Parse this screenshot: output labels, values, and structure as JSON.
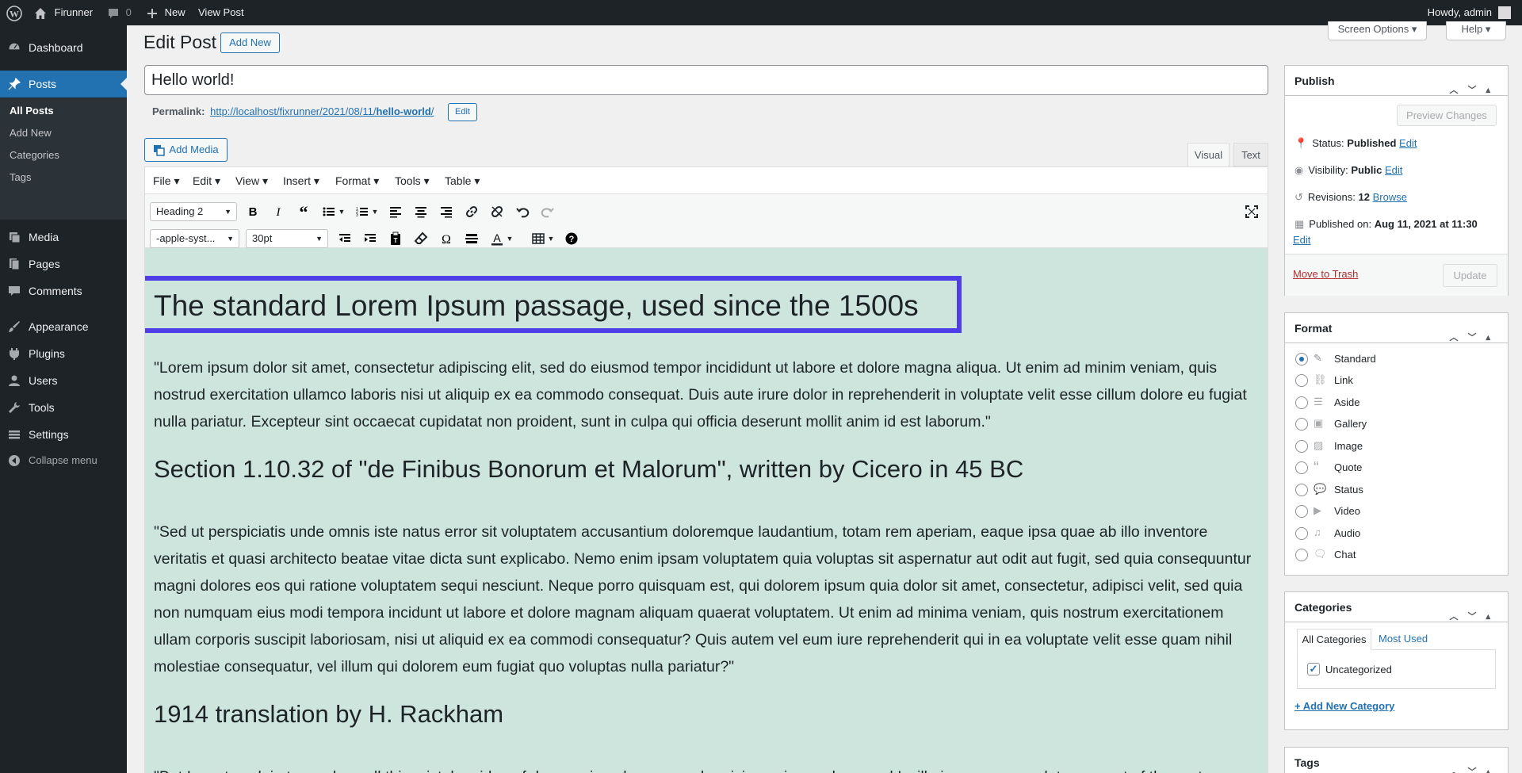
{
  "adminbar": {
    "site_name": "Firunner",
    "comments_count": "0",
    "new_label": "New",
    "view_post_label": "View Post",
    "howdy": "Howdy, admin"
  },
  "sidebar": {
    "items": [
      {
        "label": "Dashboard",
        "icon": "dashboard-icon"
      },
      {
        "label": "Posts",
        "icon": "pushpin-icon"
      },
      {
        "label": "Media",
        "icon": "media-icon"
      },
      {
        "label": "Pages",
        "icon": "pages-icon"
      },
      {
        "label": "Comments",
        "icon": "comments-icon"
      },
      {
        "label": "Appearance",
        "icon": "brush-icon"
      },
      {
        "label": "Plugins",
        "icon": "plugin-icon"
      },
      {
        "label": "Users",
        "icon": "users-icon"
      },
      {
        "label": "Tools",
        "icon": "wrench-icon"
      },
      {
        "label": "Settings",
        "icon": "settings-icon"
      },
      {
        "label": "Collapse menu",
        "icon": "collapse-icon"
      }
    ],
    "posts_sub": [
      "All Posts",
      "Add New",
      "Categories",
      "Tags"
    ]
  },
  "header": {
    "title": "Edit Post",
    "add_new": "Add New",
    "screen_options": "Screen Options",
    "help": "Help"
  },
  "post": {
    "title": "Hello world!",
    "permalink_label": "Permalink:",
    "permalink_base": "http://localhost/fixrunner/2021/08/11/",
    "permalink_slug": "hello-world",
    "permalink_end": "/",
    "permalink_edit": "Edit"
  },
  "editor": {
    "add_media": "Add Media",
    "tab_visual": "Visual",
    "tab_text": "Text",
    "menus": [
      "File",
      "Edit",
      "View",
      "Insert",
      "Format",
      "Tools",
      "Table"
    ],
    "block_format": "Heading 2",
    "font_family": "-apple-syst...",
    "font_size": "30pt"
  },
  "content": {
    "h1": "The standard Lorem Ipsum passage, used since the 1500s",
    "p1": "\"Lorem ipsum dolor sit amet, consectetur adipiscing elit, sed do eiusmod tempor incididunt ut labore et dolore magna aliqua. Ut enim ad minim veniam, quis nostrud exercitation ullamco laboris nisi ut aliquip ex ea commodo consequat. Duis aute irure dolor in reprehenderit in voluptate velit esse cillum dolore eu fugiat nulla pariatur. Excepteur sint occaecat cupidatat non proident, sunt in culpa qui officia deserunt mollit anim id est laborum.\"",
    "h2": "Section 1.10.32 of \"de Finibus Bonorum et Malorum\", written by Cicero in 45 BC",
    "p2": "\"Sed ut perspiciatis unde omnis iste natus error sit voluptatem accusantium doloremque laudantium, totam rem aperiam, eaque ipsa quae ab illo inventore veritatis et quasi architecto beatae vitae dicta sunt explicabo. Nemo enim ipsam voluptatem quia voluptas sit aspernatur aut odit aut fugit, sed quia consequuntur magni dolores eos qui ratione voluptatem sequi nesciunt. Neque porro quisquam est, qui dolorem ipsum quia dolor sit amet, consectetur, adipisci velit, sed quia non numquam eius modi tempora incidunt ut labore et dolore magnam aliquam quaerat voluptatem. Ut enim ad minima veniam, quis nostrum exercitationem ullam corporis suscipit laboriosam, nisi ut aliquid ex ea commodi consequatur? Quis autem vel eum iure reprehenderit qui in ea voluptate velit esse quam nihil molestiae consequatur, vel illum qui dolorem eum fugiat quo voluptas nulla pariatur?\"",
    "h3": "1914 translation by H. Rackham",
    "p3": "\"But I must explain to you how all this mistaken idea of denouncing pleasure and praising pain was born and I will give you a complete account of the system"
  },
  "publish": {
    "title": "Publish",
    "preview": "Preview Changes",
    "status_label": "Status:",
    "status_value": "Published",
    "visibility_label": "Visibility:",
    "visibility_value": "Public",
    "revisions_label": "Revisions:",
    "revisions_value": "12",
    "browse": "Browse",
    "published_on_label": "Published on:",
    "published_on_value": "Aug 11, 2021 at 11:30",
    "edit": "Edit",
    "trash": "Move to Trash",
    "update": "Update"
  },
  "format": {
    "title": "Format",
    "options": [
      "Standard",
      "Link",
      "Aside",
      "Gallery",
      "Image",
      "Quote",
      "Status",
      "Video",
      "Audio",
      "Chat"
    ],
    "selected": "Standard"
  },
  "categories": {
    "title": "Categories",
    "tab_all": "All Categories",
    "tab_most": "Most Used",
    "items": [
      "Uncategorized"
    ],
    "add_new": "+ Add New Category"
  },
  "tags": {
    "title": "Tags"
  },
  "colors": {
    "accent": "#2271b1",
    "highlight": "#4f3ee8",
    "editor_bg": "#cde5dd"
  }
}
